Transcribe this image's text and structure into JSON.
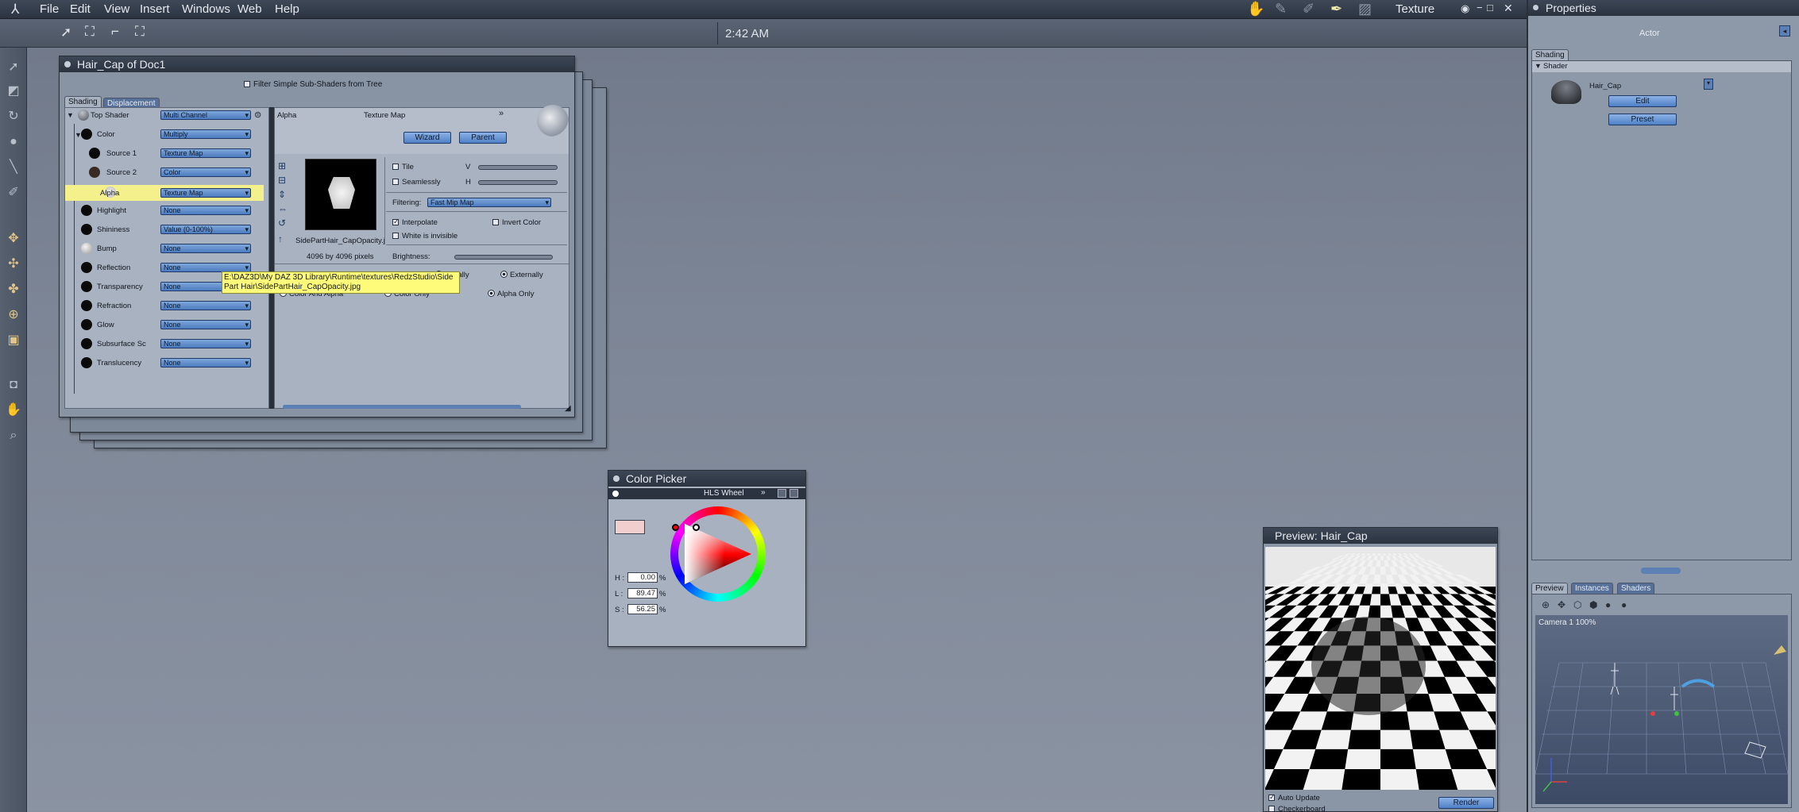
{
  "menu": {
    "items": [
      "File",
      "Edit",
      "View",
      "Insert",
      "Windows",
      "Web",
      "Help"
    ]
  },
  "top_right": {
    "room_label": "Texture"
  },
  "clock": "2:42 AM",
  "shader_window": {
    "title": "Hair_Cap of Doc1",
    "filter_label": "Filter Simple Sub-Shaders from Tree",
    "tabs": [
      "Shading",
      "Displacement"
    ],
    "tree": [
      {
        "label": "Top Shader",
        "value": "Multi Channel"
      },
      {
        "label": "Color",
        "value": "Multiply"
      },
      {
        "label": "Source 1",
        "value": "Texture Map"
      },
      {
        "label": "Source 2",
        "value": "Color"
      },
      {
        "label": "Alpha",
        "value": "Texture Map"
      },
      {
        "label": "Highlight",
        "value": "None"
      },
      {
        "label": "Shininess",
        "value": "Value (0-100%)"
      },
      {
        "label": "Bump",
        "value": "None"
      },
      {
        "label": "Reflection",
        "value": "None"
      },
      {
        "label": "Transparency",
        "value": "None"
      },
      {
        "label": "Refraction",
        "value": "None"
      },
      {
        "label": "Glow",
        "value": "None"
      },
      {
        "label": "Subsurface Sc",
        "value": "None"
      },
      {
        "label": "Translucency",
        "value": "None"
      }
    ],
    "detail": {
      "channel": "Alpha",
      "kind": "Texture Map",
      "wizard": "Wizard",
      "parent": "Parent",
      "filename": "SidePartHair_CapOpacity.j",
      "dimensions": "4096 by 4096 pixels",
      "tile": "Tile",
      "seamlessly": "Seamlessly",
      "v": "V",
      "h": "H",
      "filtering_label": "Filtering:",
      "filtering_value": "Fast Mip Map",
      "interpolate": "Interpolate",
      "invert_color": "Invert Color",
      "white_invisible": "White is invisible",
      "brightness": "Brightness:",
      "internally": "ternally",
      "externally": "Externally",
      "color_and_alpha": "Color And Alpha",
      "color_only": "Color Only",
      "alpha_only": "Alpha Only"
    },
    "tooltip": "E:\\DAZ3D\\My DAZ 3D Library\\Runtime\\textures\\RedzStudio\\Side Part Hair\\SidePartHair_CapOpacity.jpg"
  },
  "color_picker": {
    "title": "Color Picker",
    "mode": "HLS Wheel",
    "h_label": "H :",
    "h_value": "0.00",
    "l_label": "L :",
    "l_value": "89.47",
    "s_label": "S :",
    "s_value": "56.25",
    "pct": "%",
    "swatch_color": "#f1cfcf"
  },
  "preview_window": {
    "title": "Preview: Hair_Cap",
    "auto_update": "Auto Update",
    "checkerboard": "Checkerboard",
    "render": "Render"
  },
  "properties": {
    "title": "Properties",
    "actor": "Actor",
    "tab": "Shading",
    "section": "Shader",
    "item": "Hair_Cap",
    "edit": "Edit",
    "preset": "Preset"
  },
  "bottom_panel": {
    "tabs": [
      "Preview",
      "Instances",
      "Shaders"
    ],
    "camera_label": "Camera 1  100%"
  }
}
